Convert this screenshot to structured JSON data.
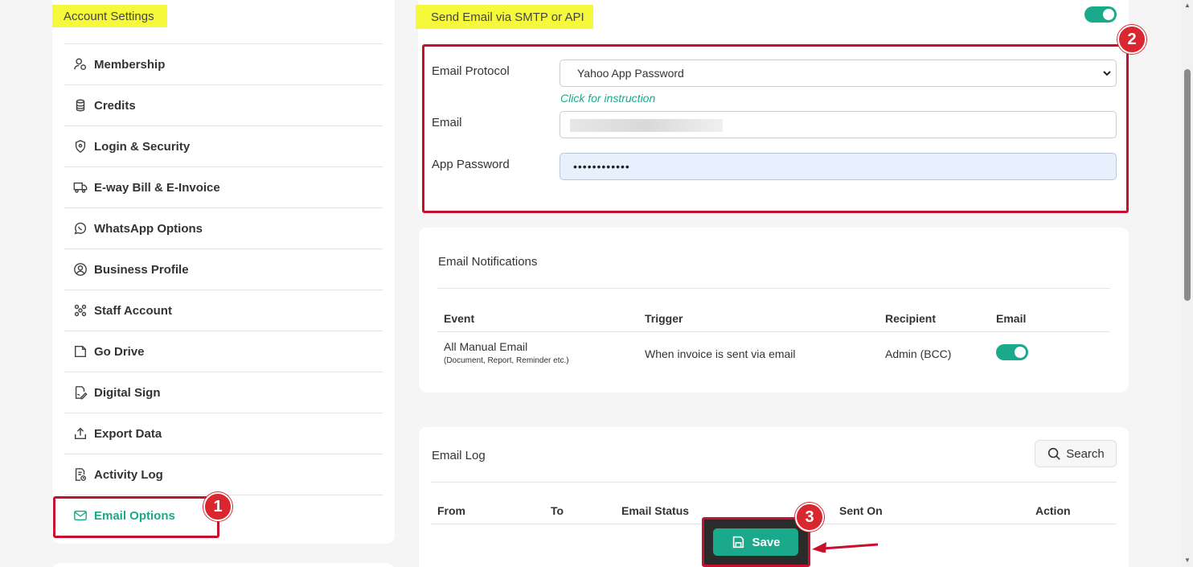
{
  "sidebar": {
    "title": "Account Settings",
    "items": [
      {
        "label": "Membership",
        "icon": "user-badge-icon"
      },
      {
        "label": "Credits",
        "icon": "coins-icon"
      },
      {
        "label": "Login & Security",
        "icon": "shield-icon"
      },
      {
        "label": "E-way Bill & E-Invoice",
        "icon": "truck-icon"
      },
      {
        "label": "WhatsApp Options",
        "icon": "whatsapp-icon"
      },
      {
        "label": "Business Profile",
        "icon": "user-circle-icon"
      },
      {
        "label": "Staff Account",
        "icon": "people-icon"
      },
      {
        "label": "Go Drive",
        "icon": "drive-icon"
      },
      {
        "label": "Digital Sign",
        "icon": "sign-icon"
      },
      {
        "label": "Export Data",
        "icon": "upload-icon"
      },
      {
        "label": "Activity Log",
        "icon": "log-icon"
      },
      {
        "label": "Email Options",
        "icon": "mail-icon",
        "active": true
      }
    ]
  },
  "smtp": {
    "title": "Send Email via SMTP or API",
    "protocol_label": "Email Protocol",
    "protocol_value": "Yahoo App Password",
    "instruction_link": "Click for instruction",
    "email_label": "Email",
    "password_label": "App Password",
    "password_value": "••••••••••••"
  },
  "notifications": {
    "title": "Email Notifications",
    "headers": [
      "Event",
      "Trigger",
      "Recipient",
      "Email"
    ],
    "row": {
      "event": "All Manual Email",
      "event_sub": "(Document, Report, Reminder etc.)",
      "trigger": "When invoice is sent via email",
      "recipient": "Admin (BCC)"
    }
  },
  "email_log": {
    "title": "Email Log",
    "search_label": "Search",
    "headers": [
      "From",
      "To",
      "Email Status",
      "Sent On",
      "Action"
    ]
  },
  "save_label": "Save",
  "annotations": [
    "1",
    "2",
    "3"
  ],
  "colors": {
    "accent": "#1aa98a",
    "highlight": "#f6f93b",
    "annotation_red": "#c8102e"
  }
}
